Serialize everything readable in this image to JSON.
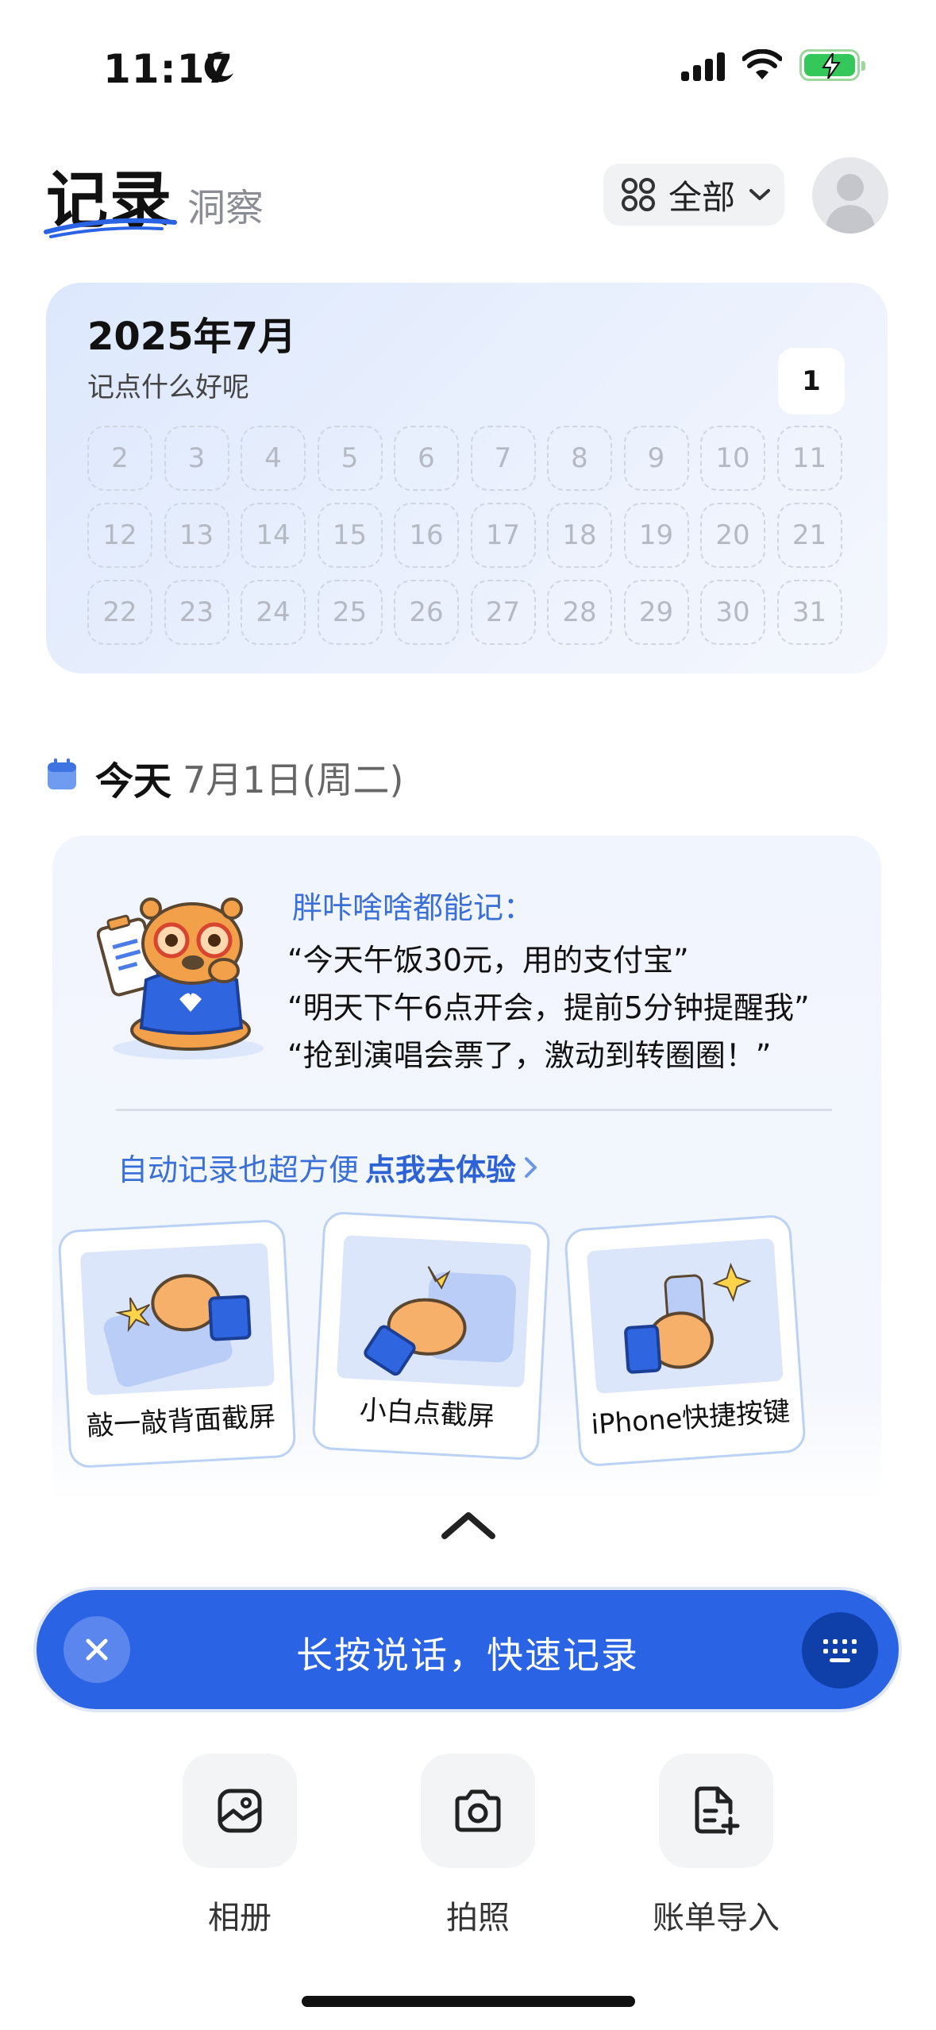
{
  "status_bar": {
    "time": "11:17"
  },
  "header": {
    "title": "记录",
    "subtitle_tab": "洞察",
    "filter_label": "全部"
  },
  "calendar": {
    "title": "2025年7月",
    "subtitle": "记点什么好呢",
    "today_day": "1",
    "days": [
      "2",
      "3",
      "4",
      "5",
      "6",
      "7",
      "8",
      "9",
      "10",
      "11",
      "12",
      "13",
      "14",
      "15",
      "16",
      "17",
      "18",
      "19",
      "20",
      "21",
      "22",
      "23",
      "24",
      "25",
      "26",
      "27",
      "28",
      "29",
      "30",
      "31"
    ]
  },
  "today": {
    "label": "今天",
    "date": "7月1日(周二)"
  },
  "tips": {
    "title": "胖咔啥啥都能记：",
    "examples": [
      "“今天午饭30元，用的支付宝”",
      "“明天下午6点开会，提前5分钟提醒我”",
      "“抢到演唱会票了，激动到转圈圈！”"
    ],
    "auto_text": "自动记录也超方便",
    "auto_link": "点我去体验",
    "features": [
      "敲一敲背面截屏",
      "小白点截屏",
      "iPhone快捷按键"
    ]
  },
  "voice_bar": {
    "label": "长按说话，快速记录"
  },
  "actions": [
    "相册",
    "拍照",
    "账单导入"
  ],
  "colors": {
    "accent": "#2a63e4",
    "link": "#3a6fd8",
    "battery": "#34c759"
  }
}
